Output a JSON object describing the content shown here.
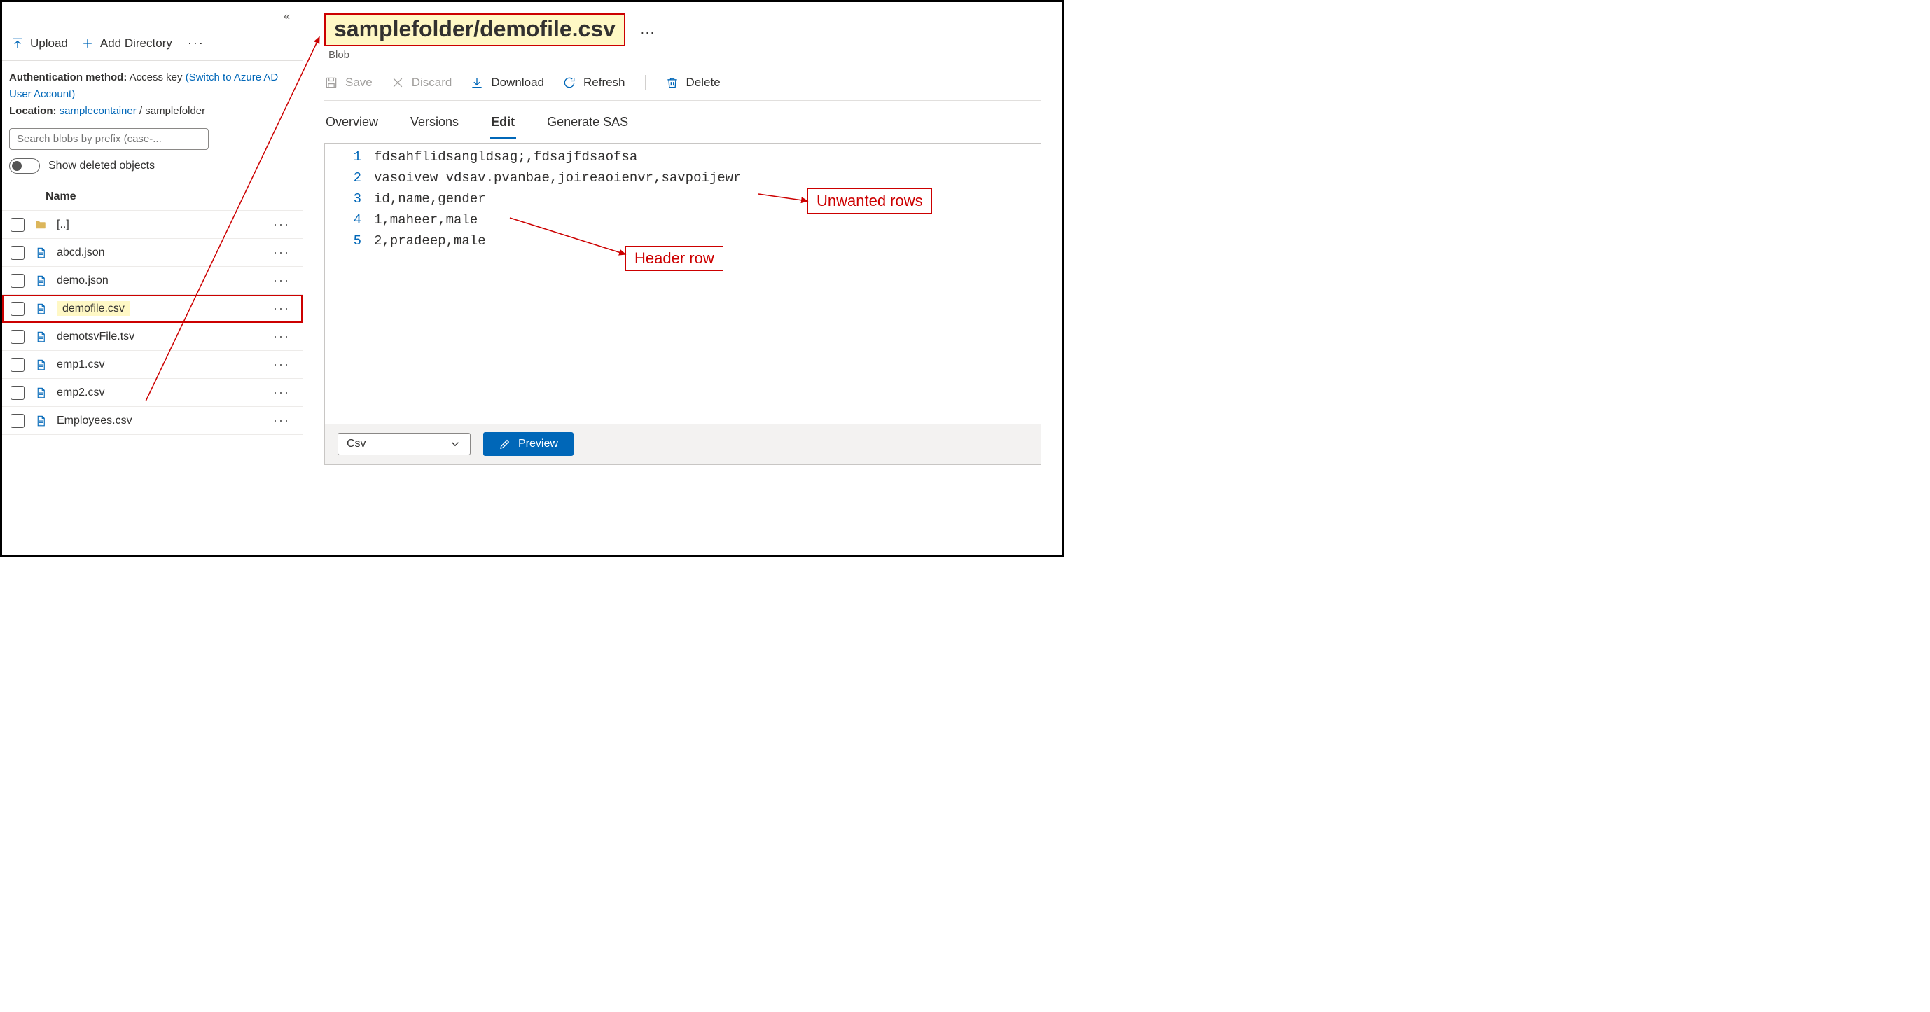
{
  "sidebar": {
    "toolbar": {
      "upload": "Upload",
      "add_dir": "Add Directory"
    },
    "auth_label": "Authentication method:",
    "auth_value": "Access key",
    "auth_switch": "(Switch to  Azure AD User Account)",
    "loc_label": "Location:",
    "loc_container": "samplecontainer",
    "loc_sep": "/",
    "loc_folder": "samplefolder",
    "search_placeholder": "Search blobs by prefix (case-...",
    "toggle_label": "Show deleted objects",
    "col_name": "Name",
    "files": [
      {
        "name": "[..]",
        "type": "folder",
        "hl": false
      },
      {
        "name": "abcd.json",
        "type": "file",
        "hl": false
      },
      {
        "name": "demo.json",
        "type": "file",
        "hl": false
      },
      {
        "name": "demofile.csv",
        "type": "file",
        "hl": true
      },
      {
        "name": "demotsvFile.tsv",
        "type": "file",
        "hl": false
      },
      {
        "name": "emp1.csv",
        "type": "file",
        "hl": false
      },
      {
        "name": "emp2.csv",
        "type": "file",
        "hl": false
      },
      {
        "name": "Employees.csv",
        "type": "file",
        "hl": false
      }
    ]
  },
  "main": {
    "title": "samplefolder/demofile.csv",
    "subtitle": "Blob",
    "more": "..."
  },
  "commands": {
    "save": "Save",
    "discard": "Discard",
    "download": "Download",
    "refresh": "Refresh",
    "delete": "Delete"
  },
  "tabs": {
    "overview": "Overview",
    "versions": "Versions",
    "edit": "Edit",
    "sas": "Generate SAS"
  },
  "editor": {
    "lines": [
      "fdsahflidsangldsag;,fdsajfdsaofsa",
      "vasoivew vdsav.pvanbae,joireaoienvr,savpoijewr",
      "id,name,gender",
      "1,maheer,male",
      "2,pradeep,male"
    ],
    "footer_select": "Csv",
    "preview": "Preview"
  },
  "annotations": {
    "unwanted": "Unwanted rows",
    "header": "Header row"
  }
}
